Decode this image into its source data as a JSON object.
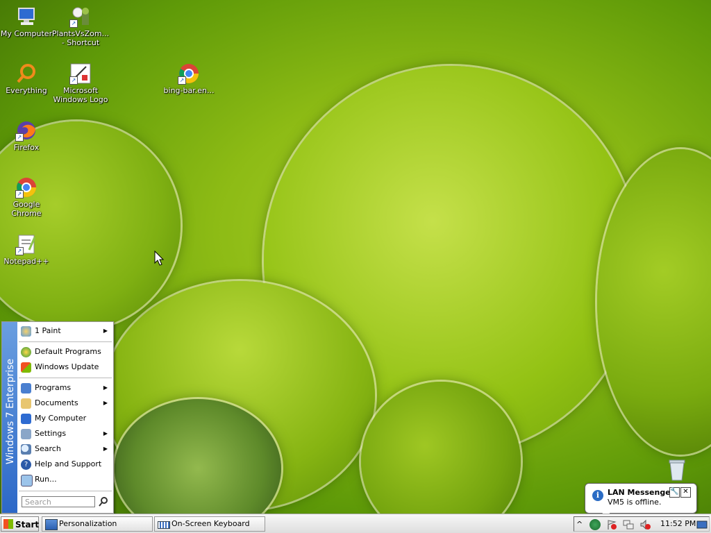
{
  "desktop": {
    "icons": [
      {
        "label": "My Computer",
        "icon": "computer-icon"
      },
      {
        "label": "PlantsVsZom... - Shortcut",
        "icon": "plants-vs-zombies-icon"
      },
      {
        "label": "Everything",
        "icon": "everything-search-icon"
      },
      {
        "label": "Microsoft Windows Logo",
        "icon": "windows-logo-kit-icon"
      },
      {
        "label": "bing-bar.en...",
        "icon": "chrome-document-icon"
      },
      {
        "label": "Firefox",
        "icon": "firefox-icon"
      },
      {
        "label": "Google Chrome",
        "icon": "chrome-icon"
      },
      {
        "label": "Notepad++",
        "icon": "notepad-plus-plus-icon"
      }
    ],
    "recycle_bin_icon": "recycle-bin-icon"
  },
  "start_menu": {
    "band_text": "Windows 7 Enterprise",
    "items": [
      {
        "label": "1 Paint",
        "submenu": true,
        "icon": "paint-icon"
      },
      {
        "label": "Default Programs",
        "submenu": false,
        "icon": "default-programs-icon"
      },
      {
        "label": "Windows Update",
        "submenu": false,
        "icon": "windows-update-icon"
      },
      {
        "label": "Programs",
        "submenu": true,
        "icon": "programs-icon"
      },
      {
        "label": "Documents",
        "submenu": true,
        "icon": "documents-icon"
      },
      {
        "label": "My Computer",
        "submenu": false,
        "icon": "computer-icon"
      },
      {
        "label": "Settings",
        "submenu": true,
        "icon": "settings-icon"
      },
      {
        "label": "Search",
        "submenu": true,
        "icon": "search-icon"
      },
      {
        "label": "Help and Support",
        "submenu": false,
        "icon": "help-icon"
      },
      {
        "label": "Run...",
        "submenu": false,
        "icon": "run-icon"
      }
    ],
    "submenu_glyph": "▶",
    "search_placeholder": "Search"
  },
  "taskbar": {
    "start_label": "Start",
    "buttons": [
      {
        "label": "Personalization",
        "icon": "personalization-icon"
      },
      {
        "label": "On-Screen Keyboard",
        "icon": "keyboard-icon"
      }
    ],
    "clock": "11:52 PM",
    "tray_icons": [
      "show-hidden-icons-chevron",
      "lan-messenger-icon",
      "action-center-flag-icon",
      "network-icon",
      "volume-muted-icon",
      "show-desktop-icon"
    ]
  },
  "balloon": {
    "title": "LAN Messenger",
    "message": "VM5 is offline.",
    "settings_glyph": "🔧",
    "close_glyph": "✕",
    "info_glyph": "i",
    "chevron_glyph": "^"
  }
}
